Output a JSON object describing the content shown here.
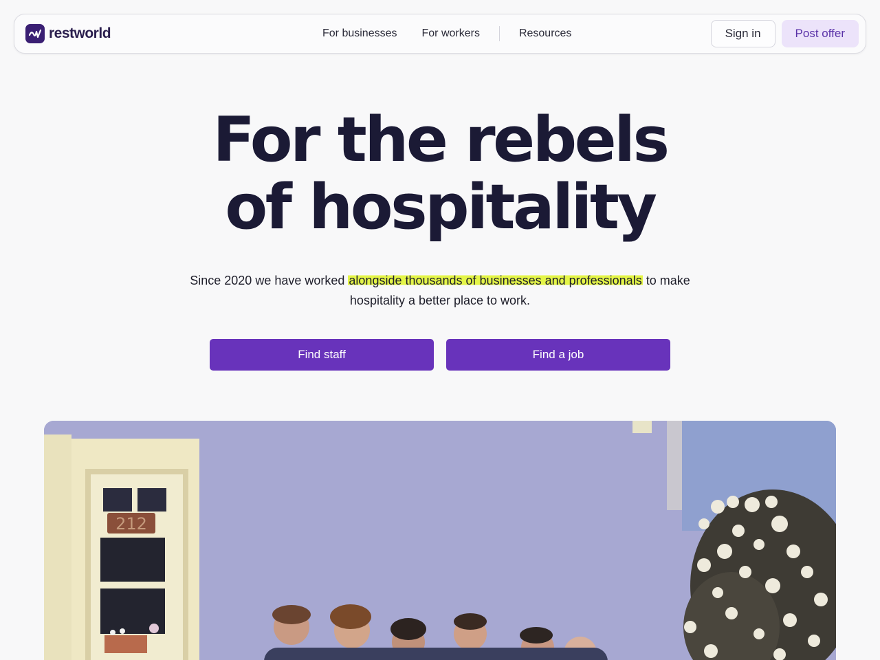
{
  "brand": {
    "name": "restworld",
    "logo_icon": "restworld-logo-mark",
    "color": "#3a1f73"
  },
  "nav": {
    "links": [
      "For businesses",
      "For workers",
      "Resources"
    ],
    "sign_in": "Sign in",
    "post_offer": "Post offer"
  },
  "hero": {
    "title_line1": "For the rebels",
    "title_line2": "of hospitality",
    "subtitle_before": "Since 2020 we have worked ",
    "subtitle_highlight": "alongside thousands of businesses and professionals",
    "subtitle_after": " to make hospitality a better place to work.",
    "highlight_color": "#e4f548",
    "cta_staff": "Find staff",
    "cta_job": "Find a job",
    "cta_color": "#6833bb"
  },
  "photo": {
    "door_number": "212"
  }
}
